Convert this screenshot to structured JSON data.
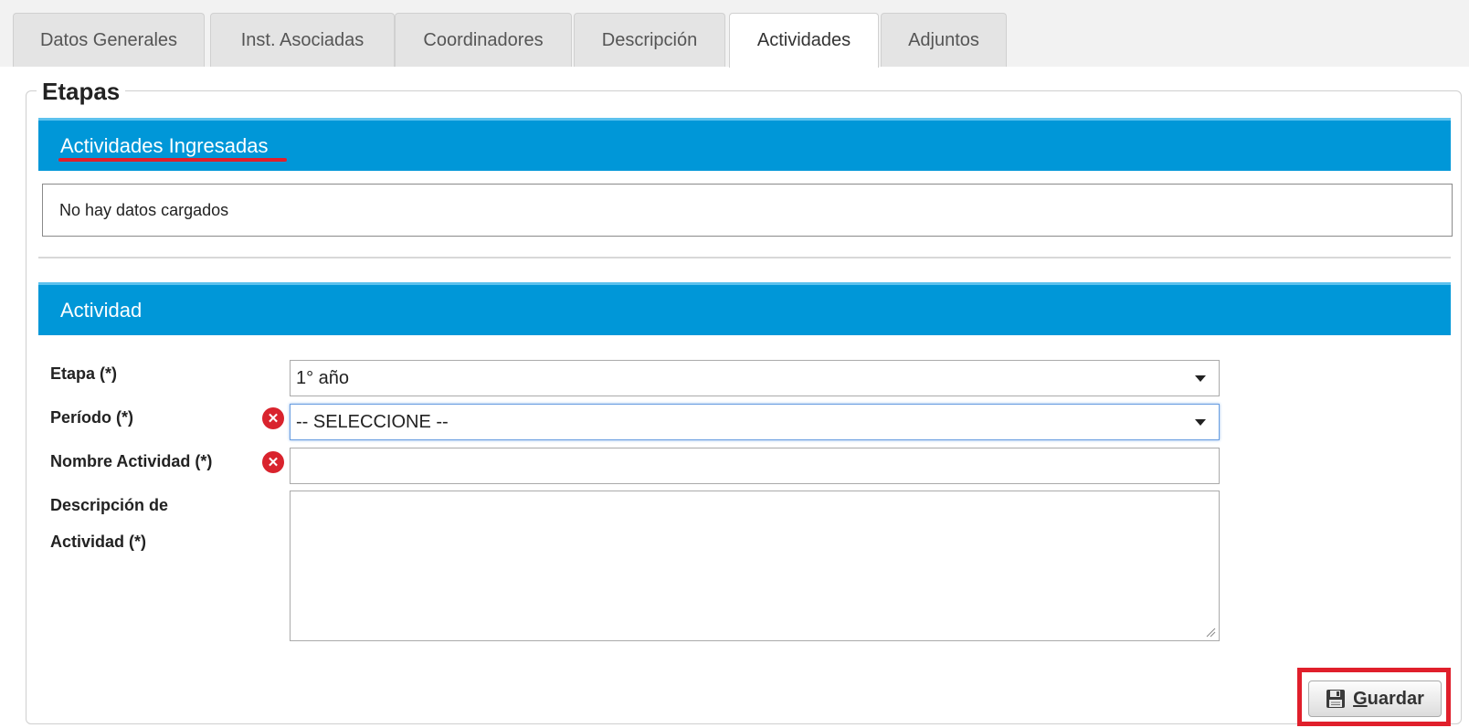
{
  "tabs": [
    {
      "label": "Datos Generales",
      "active": false
    },
    {
      "label": "Inst. Asociadas",
      "active": false
    },
    {
      "label": "Coordinadores",
      "active": false
    },
    {
      "label": "Descripción",
      "active": false
    },
    {
      "label": "Actividades",
      "active": true
    },
    {
      "label": "Adjuntos",
      "active": false
    }
  ],
  "fieldset": {
    "legend": "Etapas"
  },
  "ingresadas": {
    "header": "Actividades Ingresadas",
    "empty_text": "No hay datos cargados"
  },
  "actividad": {
    "header": "Actividad",
    "etapa": {
      "label": "Etapa (*)",
      "value": "1° año"
    },
    "periodo": {
      "label": "Período (*)",
      "value": "-- SELECCIONE --"
    },
    "nombre": {
      "label": "Nombre Actividad (*)",
      "value": ""
    },
    "descripcion": {
      "label_line1": "Descripción de",
      "label_line2": "Actividad (*)",
      "value": ""
    },
    "error_icon_glyph": "✕"
  },
  "save_button": {
    "first_letter": "G",
    "rest": "uardar",
    "icon": "floppy-disk-icon"
  },
  "colors": {
    "accent": "#0097d8",
    "highlight": "#e01f2b",
    "error": "#d9232d"
  }
}
